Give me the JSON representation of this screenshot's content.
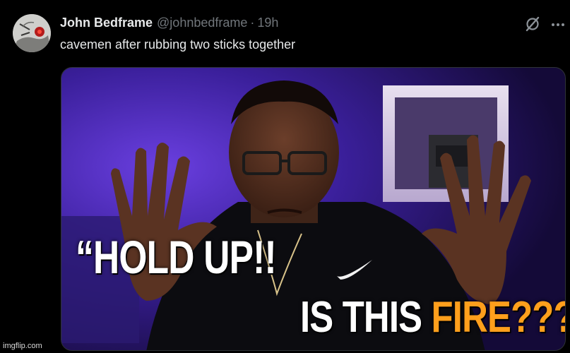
{
  "tweet": {
    "display_name": "John Bedframe",
    "handle": "@johnbedframe",
    "separator": "·",
    "time": "19h",
    "text": "cavemen after rubbing two sticks together"
  },
  "icons": {
    "grok": "grok-icon",
    "more": "more-icon",
    "avatar": "avatar"
  },
  "media": {
    "caption_line_1": "“HOLD UP!!",
    "caption_line_2_white": "IS THIS ",
    "caption_line_2_accent": "FIRE???",
    "caption_line_2_end": "”"
  },
  "watermark": "imgflip.com",
  "colors": {
    "background": "#000000",
    "text_primary": "#e7e9ea",
    "text_secondary": "#71767b",
    "caption_accent": "#ff9f1c",
    "caption_white": "#ffffff",
    "backdrop_purple": "#3a1f9a"
  }
}
